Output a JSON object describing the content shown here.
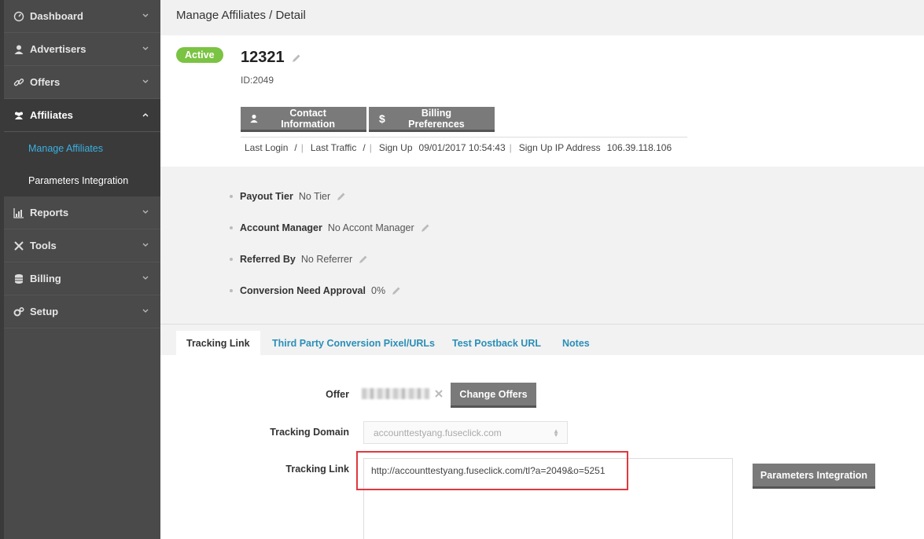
{
  "sidebar": {
    "items": [
      {
        "label": "Dashboard",
        "icon": "dashboard-icon"
      },
      {
        "label": "Advertisers",
        "icon": "user-icon"
      },
      {
        "label": "Offers",
        "icon": "link-icon"
      },
      {
        "label": "Affiliates",
        "icon": "users-icon",
        "expanded": true
      },
      {
        "label": "Reports",
        "icon": "chart-icon"
      },
      {
        "label": "Tools",
        "icon": "tools-icon"
      },
      {
        "label": "Billing",
        "icon": "database-icon"
      },
      {
        "label": "Setup",
        "icon": "cogs-icon"
      }
    ],
    "subitems": [
      {
        "label": "Manage Affiliates",
        "current": true
      },
      {
        "label": "Parameters Integration",
        "current": false
      }
    ]
  },
  "breadcrumb": "Manage Affiliates / Detail",
  "header": {
    "status": "Active",
    "name": "12321",
    "id_text": "ID:2049",
    "contact_button": "Contact Information",
    "billing_button": "Billing Preferences",
    "meta": {
      "last_login_label": "Last Login",
      "last_login_value": "/",
      "last_traffic_label": "Last Traffic",
      "last_traffic_value": "/",
      "signup_label": "Sign Up",
      "signup_value": "09/01/2017 10:54:43",
      "signup_ip_label": "Sign Up IP Address",
      "signup_ip_value": "106.39.118.106"
    }
  },
  "info": {
    "payout_tier_label": "Payout Tier",
    "payout_tier_value": "No Tier",
    "account_manager_label": "Account Manager",
    "account_manager_value": "No Accont Manager",
    "referred_by_label": "Referred By",
    "referred_by_value": "No Referrer",
    "conversion_label": "Conversion Need Approval",
    "conversion_value": "0%"
  },
  "tabs": [
    "Tracking Link",
    "Third Party Conversion Pixel/URLs",
    "Test Postback URL",
    "Notes"
  ],
  "tracking": {
    "offer_label": "Offer",
    "change_offers_button": "Change Offers",
    "domain_label": "Tracking Domain",
    "domain_value": "accounttestyang.fuseclick.com",
    "link_label": "Tracking Link",
    "link_value": "http://accounttestyang.fuseclick.com/tl?a=2049&o=5251",
    "params_button": "Parameters Integration"
  },
  "colors": {
    "sidebar_bg": "#4a4a4a",
    "active_badge": "#7bc343",
    "link_blue": "#2a8fb8",
    "highlight_red": "#e0383e"
  }
}
